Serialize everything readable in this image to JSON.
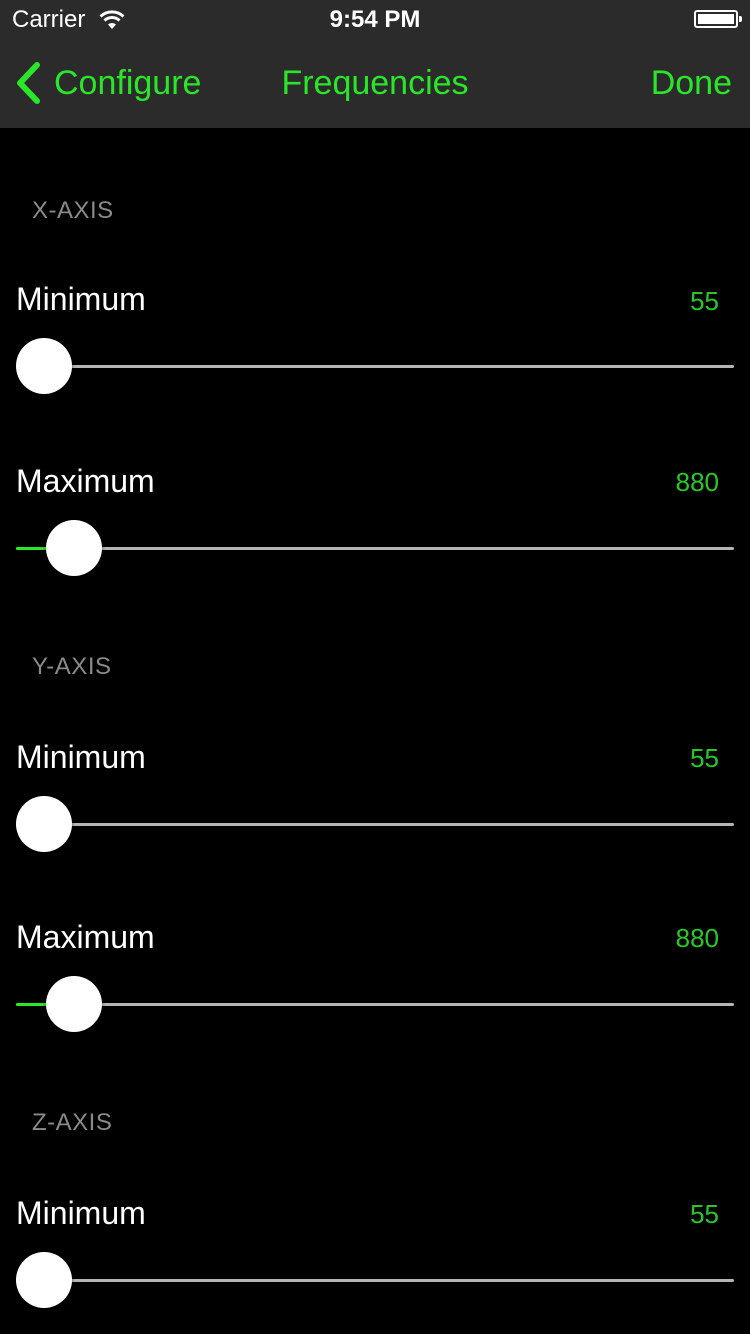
{
  "status_bar": {
    "carrier": "Carrier",
    "time": "9:54 PM",
    "wifi_icon": "wifi-icon",
    "battery_icon": "battery-icon"
  },
  "nav": {
    "back_label": "Configure",
    "back_icon": "chevron-left-icon",
    "title": "Frequencies",
    "done_label": "Done"
  },
  "colors": {
    "accent": "#29e629",
    "value": "#29c829",
    "header": "#8a8a8a",
    "bar": "#2b2b2b",
    "track": "#b5b5b5"
  },
  "sections": [
    {
      "header": "X-AXIS",
      "rows": [
        {
          "label": "Minimum",
          "value": "55",
          "level": 0.0
        },
        {
          "label": "Maximum",
          "value": "880",
          "level": 0.045
        }
      ]
    },
    {
      "header": "Y-AXIS",
      "rows": [
        {
          "label": "Minimum",
          "value": "55",
          "level": 0.0
        },
        {
          "label": "Maximum",
          "value": "880",
          "level": 0.045
        }
      ]
    },
    {
      "header": "Z-AXIS",
      "rows": [
        {
          "label": "Minimum",
          "value": "55",
          "level": 0.0
        }
      ]
    }
  ]
}
